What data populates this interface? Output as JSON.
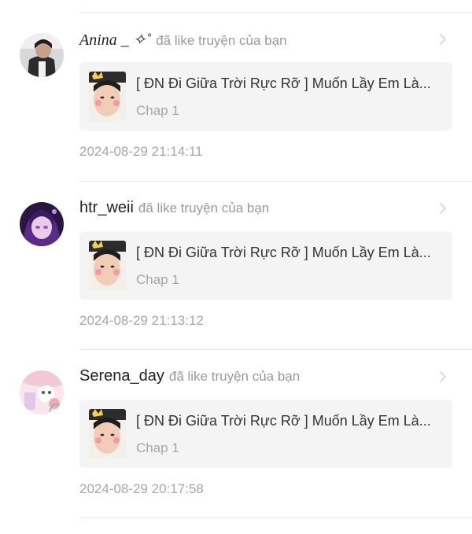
{
  "notifications": [
    {
      "username": "Anina _ ✧˚",
      "action": "đã like truyện của bạn",
      "story_title": "[ ĐN Đi Giữa Trời Rực Rỡ ] Muốn Lầy Em Là...",
      "chapter": "Chap 1",
      "timestamp": "2024-08-29 21:14:11",
      "avatar_style": "dark-selfie"
    },
    {
      "username": "htr_weii",
      "action": "đã like truyện của bạn",
      "story_title": "[ ĐN Đi Giữa Trời Rực Rỡ ] Muốn Lầy Em Là...",
      "chapter": "Chap 1",
      "timestamp": "2024-08-29 21:13:12",
      "avatar_style": "purple-anime"
    },
    {
      "username": "Serena_day",
      "action": "đã like truyện của bạn",
      "story_title": "[ ĐN Đi Giữa Trời Rực Rỡ ] Muốn Lầy Em Là...",
      "chapter": "Chap 1",
      "timestamp": "2024-08-29 20:17:58",
      "avatar_style": "pastel-floral"
    }
  ],
  "icons": {
    "chevron": "chevron-right-icon",
    "thumbnail": "story-cover-thumbnail"
  },
  "colors": {
    "card_bg": "#f4f4f5",
    "muted_text": "#a6a6a6",
    "divider": "#e6e6e6"
  }
}
